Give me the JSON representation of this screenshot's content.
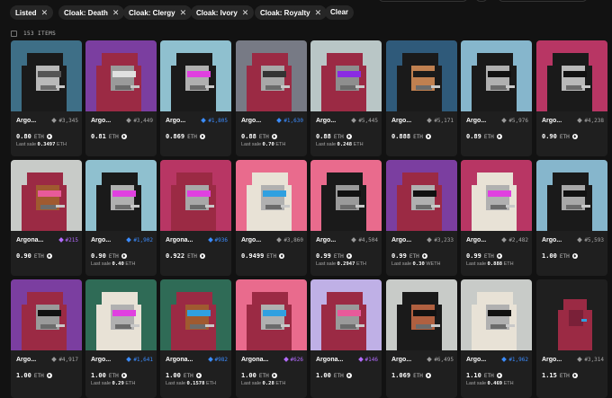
{
  "filters": [
    {
      "label": "Listed",
      "close": "✕"
    },
    {
      "label": "Cloak: Death",
      "close": "✕"
    },
    {
      "label": "Cloak: Clergy",
      "close": "✕"
    },
    {
      "label": "Cloak: Ivory",
      "close": "✕"
    },
    {
      "label": "Cloak: Royalty",
      "close": "✕"
    }
  ],
  "clear_label": "Clear",
  "items_count": "153 ITEMS",
  "colors": {
    "blue_gem": "#3b8cff",
    "purple_gem": "#b36bff",
    "grey_gem": "#9a9a9a"
  },
  "last_sale_label": "Last sale",
  "cards": [
    {
      "name": "Argo...",
      "rank": "#3,345",
      "gem": "grey",
      "price": "0.80",
      "currency": "ETH",
      "last_sale": "0.3497",
      "last_cur": "ETH",
      "bg": "#3e6f87",
      "cloak": "#1a1a1a",
      "face": "#b9b9b9",
      "glasses": "#555555"
    },
    {
      "name": "Argo...",
      "rank": "#3,449",
      "gem": "grey",
      "price": "0.81",
      "currency": "ETH",
      "last_sale": "",
      "last_cur": "",
      "bg": "#7b3ea0",
      "cloak": "#9b2a44",
      "face": "#9a9a9a",
      "glasses": "#e0e0e0"
    },
    {
      "name": "Argo...",
      "rank": "#1,805",
      "gem": "blue",
      "price": "0.869",
      "currency": "ETH",
      "last_sale": "",
      "last_cur": "",
      "bg": "#8fc0cf",
      "cloak": "#1a1a1a",
      "face": "#b0b0b0",
      "glasses": "#e040e0"
    },
    {
      "name": "Argo...",
      "rank": "#1,630",
      "gem": "blue",
      "price": "0.88",
      "currency": "ETH",
      "last_sale": "0.70",
      "last_cur": "ETH",
      "bg": "#777a85",
      "cloak": "#9b2a44",
      "face": "#a8a8a8",
      "glasses": "#333333"
    },
    {
      "name": "Argo...",
      "rank": "#5,445",
      "gem": "grey",
      "price": "0.88",
      "currency": "ETH",
      "last_sale": "0.248",
      "last_cur": "ETH",
      "bg": "#b9c6c6",
      "cloak": "#9b2a44",
      "face": "#8e8e8e",
      "glasses": "#8a2be2"
    },
    {
      "name": "Argo...",
      "rank": "#5,171",
      "gem": "grey",
      "price": "0.888",
      "currency": "ETH",
      "last_sale": "",
      "last_cur": "",
      "bg": "#2f5a7a",
      "cloak": "#1a1a1a",
      "face": "#c08050",
      "glasses": "#1a1a1a"
    },
    {
      "name": "Argo...",
      "rank": "#5,976",
      "gem": "grey",
      "price": "0.89",
      "currency": "ETH",
      "last_sale": "",
      "last_cur": "",
      "bg": "#86b6cc",
      "cloak": "#1a1a1a",
      "face": "#b0b0b0",
      "glasses": "#111111"
    },
    {
      "name": "Argo...",
      "rank": "#4,238",
      "gem": "grey",
      "price": "0.90",
      "currency": "ETH",
      "last_sale": "",
      "last_cur": "",
      "bg": "#b83664",
      "cloak": "#1a1a1a",
      "face": "#b9b9b9",
      "glasses": "#111111"
    },
    {
      "name": "Argona...",
      "rank": "#215",
      "gem": "purple",
      "price": "0.90",
      "currency": "ETH",
      "last_sale": "",
      "last_cur": "",
      "bg": "#c8cbc8",
      "cloak": "#9b2a44",
      "face": "#a05a30",
      "glasses": "#e85a9a"
    },
    {
      "name": "Argo...",
      "rank": "#1,902",
      "gem": "blue",
      "price": "0.90",
      "currency": "ETH",
      "last_sale": "0.40",
      "last_cur": "ETH",
      "bg": "#8fc0cf",
      "cloak": "#1a1a1a",
      "face": "#b0b0b0",
      "glasses": "#e040e0"
    },
    {
      "name": "Argona...",
      "rank": "#936",
      "gem": "blue",
      "price": "0.922",
      "currency": "ETH",
      "last_sale": "",
      "last_cur": "",
      "bg": "#b83664",
      "cloak": "#9b2a44",
      "face": "#a8a8a8",
      "glasses": "#e040e0"
    },
    {
      "name": "Argo...",
      "rank": "#3,860",
      "gem": "grey",
      "price": "0.9499",
      "currency": "ETH",
      "last_sale": "",
      "last_cur": "",
      "bg": "#e96b8d",
      "cloak": "#e8e2d6",
      "face": "#b0b0b0",
      "glasses": "#30a0e0"
    },
    {
      "name": "Argo...",
      "rank": "#4,504",
      "gem": "grey",
      "price": "0.99",
      "currency": "ETH",
      "last_sale": "0.2947",
      "last_cur": "ETH",
      "bg": "#e96b8d",
      "cloak": "#1a1a1a",
      "face": "#9a9a9a",
      "glasses": "#111111"
    },
    {
      "name": "Argo...",
      "rank": "#3,233",
      "gem": "grey",
      "price": "0.99",
      "currency": "ETH",
      "last_sale": "0.30",
      "last_cur": "WETH",
      "bg": "#7b3ea0",
      "cloak": "#9b2a44",
      "face": "#b0b0b0",
      "glasses": "#111111"
    },
    {
      "name": "Argo...",
      "rank": "#2,482",
      "gem": "grey",
      "price": "0.99",
      "currency": "ETH",
      "last_sale": "0.888",
      "last_cur": "ETH",
      "bg": "#b83664",
      "cloak": "#e8e2d6",
      "face": "#b0b0b0",
      "glasses": "#e040e0"
    },
    {
      "name": "Argo...",
      "rank": "#5,593",
      "gem": "grey",
      "price": "1.00",
      "currency": "ETH",
      "last_sale": "",
      "last_cur": "",
      "bg": "#86b6cc",
      "cloak": "#1a1a1a",
      "face": "#a8a8a8",
      "glasses": "#111111"
    },
    {
      "name": "Argo...",
      "rank": "#4,917",
      "gem": "grey",
      "price": "1.00",
      "currency": "ETH",
      "last_sale": "",
      "last_cur": "",
      "bg": "#7b3ea0",
      "cloak": "#9b2a44",
      "face": "#9a9a9a",
      "glasses": "#111111"
    },
    {
      "name": "Argo...",
      "rank": "#1,641",
      "gem": "blue",
      "price": "1.00",
      "currency": "ETH",
      "last_sale": "0.29",
      "last_cur": "ETH",
      "bg": "#2f6b56",
      "cloak": "#e8e2d6",
      "face": "#b0b0b0",
      "glasses": "#e040e0"
    },
    {
      "name": "Argona...",
      "rank": "#982",
      "gem": "blue",
      "price": "1.00",
      "currency": "ETH",
      "last_sale": "0.1578",
      "last_cur": "ETH",
      "bg": "#2f6b56",
      "cloak": "#9b2a44",
      "face": "#a05a30",
      "glasses": "#30a0e0"
    },
    {
      "name": "Argona...",
      "rank": "#626",
      "gem": "purple",
      "price": "1.00",
      "currency": "ETH",
      "last_sale": "0.28",
      "last_cur": "ETH",
      "bg": "#e96b8d",
      "cloak": "#9b2a44",
      "face": "#b0b0b0",
      "glasses": "#30a0e0"
    },
    {
      "name": "Argona...",
      "rank": "#146",
      "gem": "purple",
      "price": "1.00",
      "currency": "ETH",
      "last_sale": "",
      "last_cur": "",
      "bg": "#bfb0e6",
      "cloak": "#9b2a44",
      "face": "#9a9a9a",
      "glasses": "#e85a9a"
    },
    {
      "name": "Argo...",
      "rank": "#6,495",
      "gem": "grey",
      "price": "1.069",
      "currency": "ETH",
      "last_sale": "",
      "last_cur": "",
      "bg": "#c8cbc8",
      "cloak": "#1a1a1a",
      "face": "#b06040",
      "glasses": "#111111"
    },
    {
      "name": "Argo...",
      "rank": "#1,962",
      "gem": "blue",
      "price": "1.10",
      "currency": "ETH",
      "last_sale": "0.469",
      "last_cur": "ETH",
      "bg": "#c8cbc8",
      "cloak": "#e8e2d6",
      "face": "#b0b0b0",
      "glasses": "#111111"
    },
    {
      "name": "Argo...",
      "rank": "#3,314",
      "gem": "grey",
      "price": "1.15",
      "currency": "ETH",
      "last_sale": "",
      "last_cur": "",
      "bg": "#1f1f1f",
      "cloak": "#9b2a44",
      "face": "#9b2a44",
      "glasses": "#9b2a44"
    }
  ]
}
